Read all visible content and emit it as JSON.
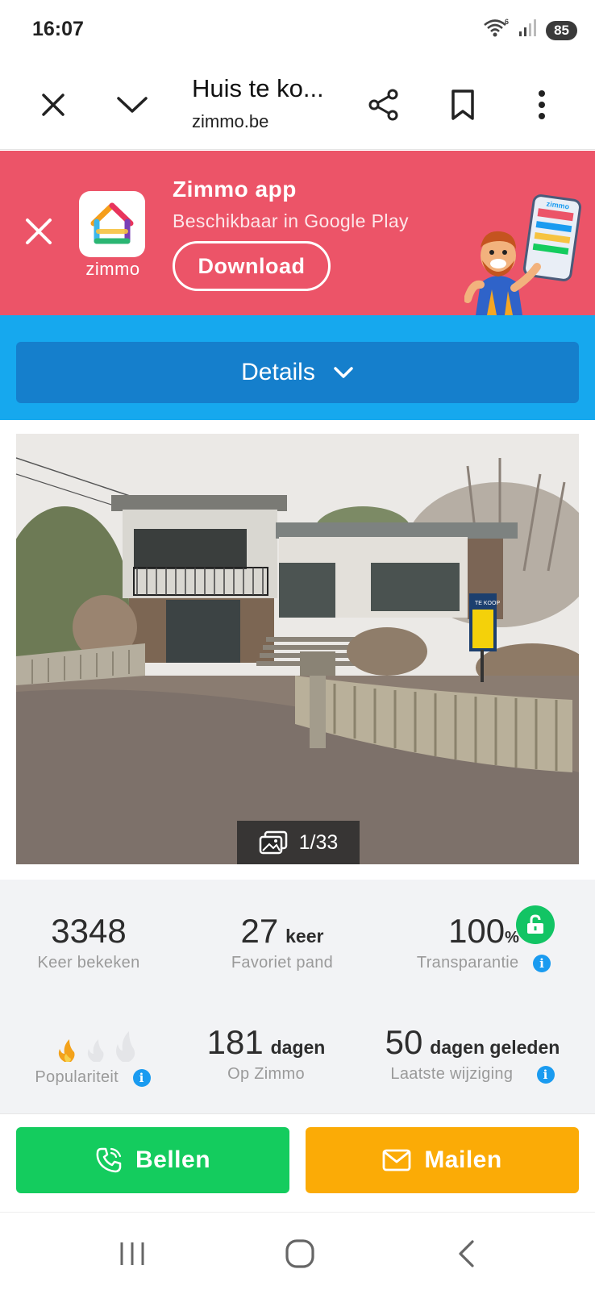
{
  "status_bar": {
    "time": "16:07",
    "battery": "85",
    "icons": [
      "wifi-6-icon",
      "signal-icon",
      "battery-icon"
    ]
  },
  "browser": {
    "title": "Huis te ko...",
    "url": "zimmo.be",
    "icons": [
      "close-icon",
      "chevron-down-icon",
      "share-icon",
      "bookmark-icon",
      "more-vert-icon"
    ]
  },
  "app_banner": {
    "app_name": "Zimmo app",
    "subtitle": "Beschikbaar in Google Play",
    "download_label": "Download",
    "logo_text": "zimmo",
    "mascot_phone_text": "zimmo",
    "background_color": "#ec5468"
  },
  "details": {
    "label": "Details"
  },
  "photo": {
    "counter": "1/33",
    "sign_text": "TE KOOP"
  },
  "stats": {
    "views_value": "3348",
    "views_label": "Keer bekeken",
    "favorites_value": "27",
    "favorites_unit": "keer",
    "favorites_label": "Favoriet pand",
    "transparency_value": "100",
    "transparency_unit": "%",
    "transparency_label": "Transparantie",
    "popularity_label": "Populariteit",
    "popularity_level": 1,
    "popularity_max": 3,
    "days_value": "181",
    "days_unit": "dagen",
    "days_label": "Op Zimmo",
    "changed_value": "50",
    "changed_unit": "dagen geleden",
    "changed_label": "Laatste wijziging",
    "info_glyph": "i"
  },
  "actions": {
    "call_label": "Bellen",
    "mail_label": "Mailen",
    "call_color": "#14cc5e",
    "mail_color": "#fbab06"
  },
  "nav": {
    "icons": [
      "recent-apps-icon",
      "home-icon",
      "back-icon"
    ]
  }
}
